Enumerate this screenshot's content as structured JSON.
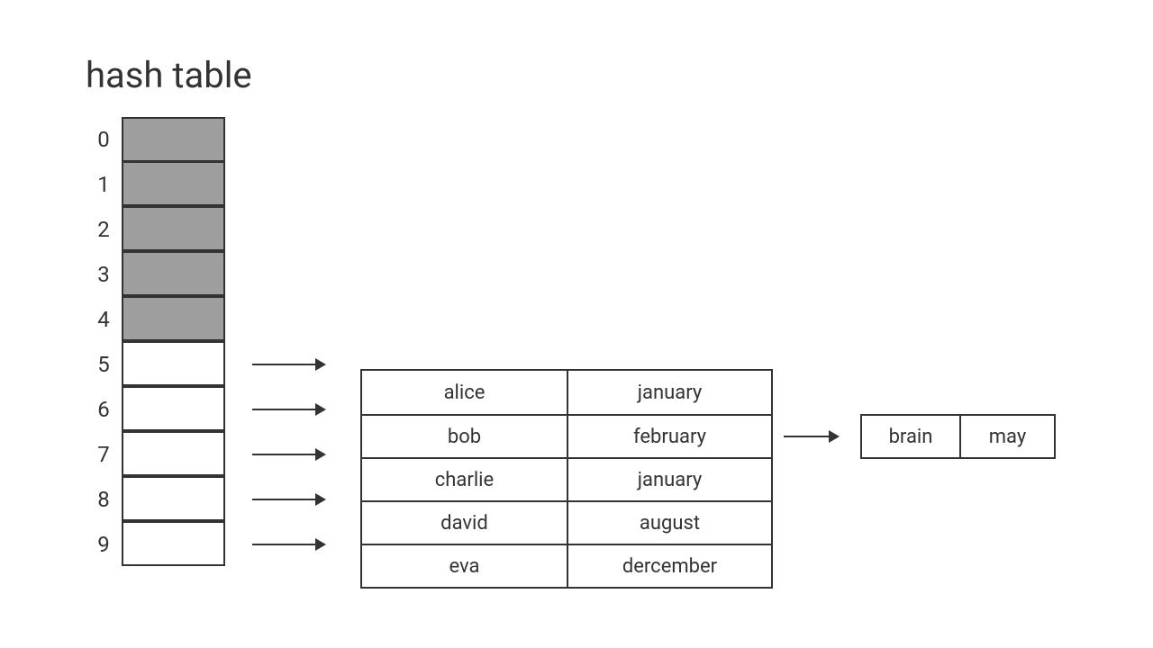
{
  "title": "hash table",
  "buckets": [
    {
      "index": "0",
      "hasNode": false
    },
    {
      "index": "1",
      "hasNode": false
    },
    {
      "index": "2",
      "hasNode": false
    },
    {
      "index": "3",
      "hasNode": false
    },
    {
      "index": "4",
      "hasNode": false
    },
    {
      "index": "5",
      "hasNode": true,
      "key": "alice",
      "value": "january"
    },
    {
      "index": "6",
      "hasNode": true,
      "key": "bob",
      "value": "february",
      "chain": {
        "key": "brain",
        "value": "may"
      }
    },
    {
      "index": "7",
      "hasNode": true,
      "key": "charlie",
      "value": "january"
    },
    {
      "index": "8",
      "hasNode": true,
      "key": "david",
      "value": "august"
    },
    {
      "index": "9",
      "hasNode": true,
      "key": "eva",
      "value": "dercember"
    }
  ]
}
